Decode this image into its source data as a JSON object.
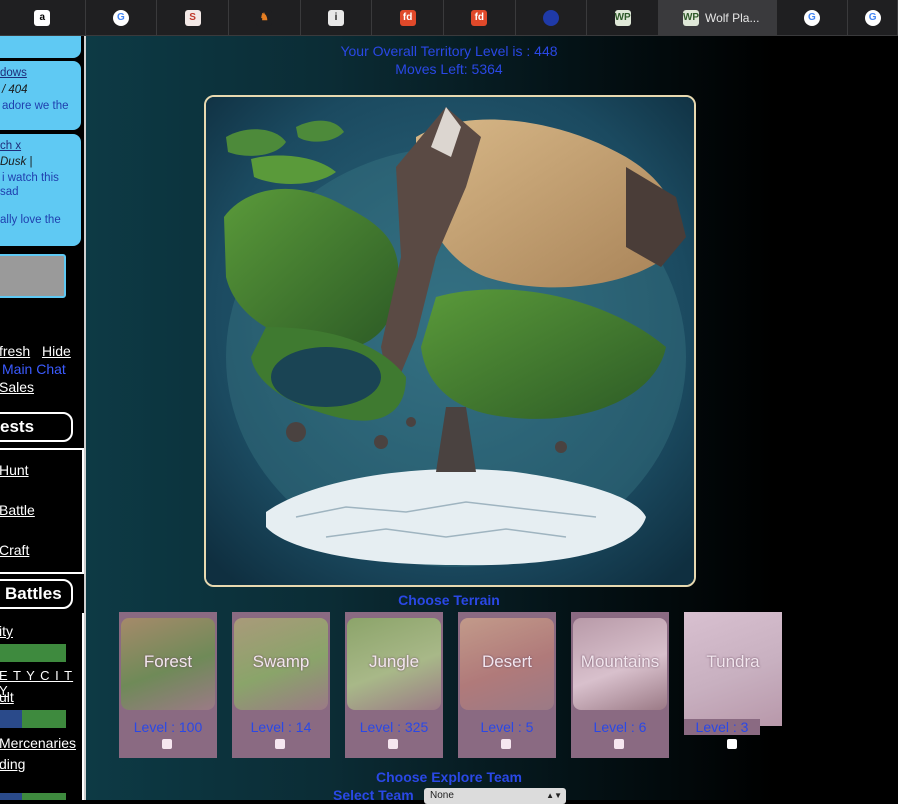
{
  "browser": {
    "tabs": [
      {
        "icon": "amazon-icon",
        "glyph": "a",
        "bg": "#ffffff",
        "fg": "#000000"
      },
      {
        "icon": "google-icon",
        "glyph": "G",
        "bg": "#ffffff",
        "fg": "#4285f4"
      },
      {
        "icon": "s-site-icon",
        "glyph": "S",
        "bg": "#f3e9e7",
        "fg": "#c0392b"
      },
      {
        "icon": "fox-icon",
        "glyph": "♞",
        "bg": "#1f1f21",
        "fg": "#e67e22"
      },
      {
        "icon": "info-icon",
        "glyph": "i",
        "bg": "#e8e8e8",
        "fg": "#222222"
      },
      {
        "icon": "fd-icon",
        "glyph": "fd",
        "bg": "#e0492a",
        "fg": "#ffffff"
      },
      {
        "icon": "fd-icon",
        "glyph": "fd",
        "bg": "#e0492a",
        "fg": "#ffffff"
      },
      {
        "icon": "nasa-icon",
        "glyph": "",
        "bg": "#1f3aa8",
        "fg": "#ffffff"
      },
      {
        "icon": "wolf-players-icon",
        "glyph": "WP",
        "bg": "#dfe8d8",
        "fg": "#2f5a2a"
      },
      {
        "icon": "wolf-players-icon",
        "glyph": "WP",
        "bg": "#dfe8d8",
        "fg": "#2f5a2a",
        "title": "Wolf Pla..."
      },
      {
        "icon": "google-icon",
        "glyph": "G",
        "bg": "#ffffff",
        "fg": "#4285f4"
      },
      {
        "icon": "google-icon",
        "glyph": "G",
        "bg": "#ffffff",
        "fg": "#4285f4"
      }
    ]
  },
  "sidebar": {
    "chat": [
      {
        "user": "dows",
        "meta": "/ 404",
        "text": "adore we the"
      },
      {
        "user": "ch x",
        "meta": "Dusk |",
        "text1": "i watch this",
        "text2": "sad",
        "text3": "ally love the"
      }
    ],
    "links": {
      "refresh": "fresh",
      "hide": "Hide",
      "main_chat": "Main Chat",
      "sales": "Sales"
    },
    "quests_pill": "ests",
    "quest_items": [
      "Hunt",
      "Battle",
      "Craft"
    ],
    "battles_pill": "Battles",
    "battle_items": [
      "ity",
      "E T Y C I T Y",
      "ult",
      "Mercenaries",
      "ding"
    ]
  },
  "main": {
    "territory_level": "Your Overall Territory Level is : 448",
    "moves_left": "Moves Left: 5364",
    "choose_terrain": "Choose Terrain",
    "terrains": [
      {
        "name": "Forest",
        "level": "Level : 100"
      },
      {
        "name": "Swamp",
        "level": "Level : 14"
      },
      {
        "name": "Jungle",
        "level": "Level : 325"
      },
      {
        "name": "Desert",
        "level": "Level : 5"
      },
      {
        "name": "Mountains",
        "level": "Level : 6"
      },
      {
        "name": "Tundra",
        "level": "Level : 3"
      }
    ],
    "choose_explore_team": "Choose Explore Team",
    "select_team_label": "Select Team",
    "select_team_value": "None"
  },
  "colors": {
    "accent_blue": "#2a48e6",
    "chat_card": "#5fc9f3",
    "terrain_card": "#8a6a82"
  }
}
